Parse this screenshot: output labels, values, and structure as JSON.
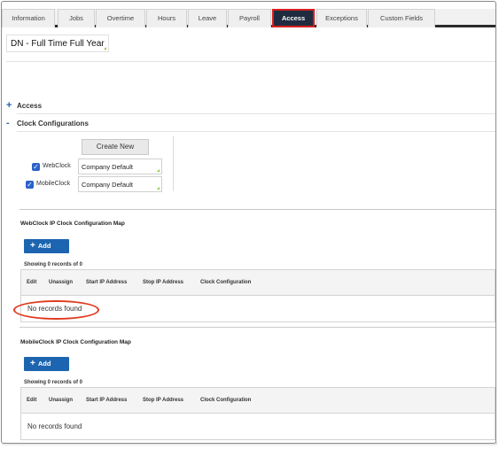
{
  "tabs": [
    {
      "label": "Information",
      "active": false
    },
    {
      "label": "Jobs",
      "active": false
    },
    {
      "label": "Overtime",
      "active": false
    },
    {
      "label": "Hours",
      "active": false
    },
    {
      "label": "Leave",
      "active": false
    },
    {
      "label": "Payroll",
      "active": false
    },
    {
      "label": "Access",
      "active": true
    },
    {
      "label": "Exceptions",
      "active": false
    },
    {
      "label": "Custom Fields",
      "active": false
    }
  ],
  "employee_title": "DN - Full Time Full Year",
  "sections": {
    "access": {
      "sign": "+",
      "label": "Access"
    },
    "clock": {
      "sign": "-",
      "label": "Clock Configurations"
    }
  },
  "clock_config": {
    "create_new_label": "Create New",
    "rows": [
      {
        "label": "WebClock",
        "checked": true,
        "value": "Company Default"
      },
      {
        "label": "MobileClock",
        "checked": true,
        "value": "Company Default"
      }
    ]
  },
  "webclock_map": {
    "title": "WebClock IP Clock Configuration Map",
    "add_label": "Add",
    "showing": "Showing 0 records of 0",
    "columns": [
      "Edit",
      "Unassign",
      "Start IP Address",
      "Stop IP Address",
      "Clock Configuration"
    ],
    "empty_text": "No records found"
  },
  "mobileclock_map": {
    "title": "MobileClock IP Clock Configuration Map",
    "add_label": "Add",
    "showing": "Showing 0 records of 0",
    "columns": [
      "Edit",
      "Unassign",
      "Start IP Address",
      "Stop IP Address",
      "Clock Configuration"
    ],
    "empty_text": "No records found"
  },
  "colors": {
    "active_tab_bg": "#1f2c3f",
    "highlight_red": "#d81f1f",
    "add_button": "#1d65b0",
    "checkbox": "#2a62c9",
    "section_sign": "#2a62a8"
  }
}
